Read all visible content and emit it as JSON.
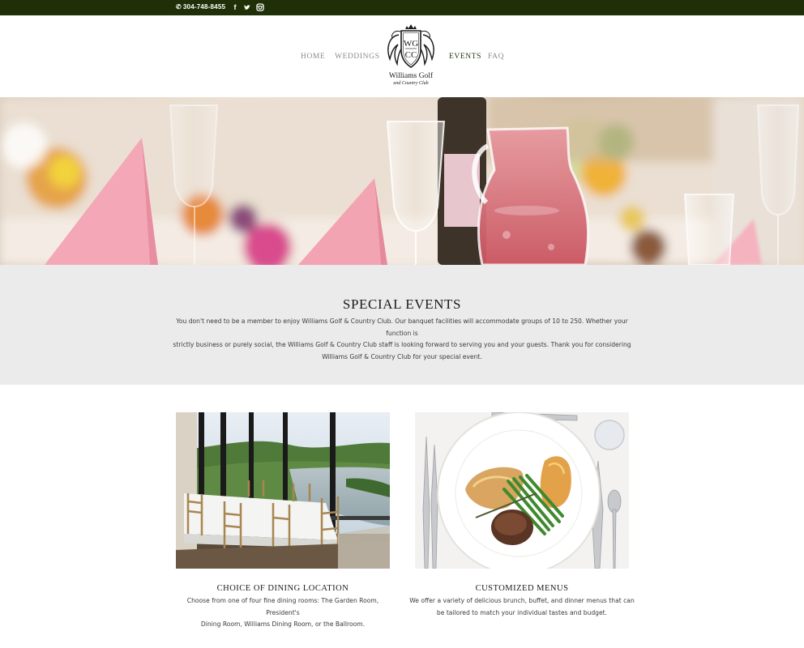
{
  "topbar": {
    "phone": "304-748-8455",
    "social": [
      "facebook-icon",
      "twitter-icon",
      "instagram-icon"
    ]
  },
  "logo": {
    "monogram_top": "WG",
    "monogram_bottom": "CC",
    "line1": "Williams Golf",
    "line2": "and Country Club"
  },
  "nav": {
    "items": [
      {
        "label": "HOME",
        "active": false
      },
      {
        "label": "WEDDINGS",
        "active": false
      },
      {
        "label": "EVENTS",
        "active": true
      },
      {
        "label": "FAQ",
        "active": false
      }
    ]
  },
  "events": {
    "title": "SPECIAL EVENTS",
    "line1": "You don't need to be a member to enjoy Williams Golf & Country Club. Our banquet facilities will accommodate groups of 10 to 250. Whether your function is",
    "line2": "strictly business or purely social, the Williams Golf & Country Club staff is looking forward to serving you and your guests.  Thank you for considering",
    "line3": "Williams Golf & Country Club for your special event."
  },
  "features": [
    {
      "title": "CHOICE OF DINING LOCATION",
      "line1": "Choose from one of four fine dining rooms: The Garden Room, President's",
      "line2": "Dining Room, Williams Dining Room, or the Ballroom."
    },
    {
      "title": "CUSTOMIZED MENUS",
      "line1": "We offer a variety of delicious brunch, buffet, and dinner menus that can",
      "line2": "be tailored to match your individual tastes and budget."
    }
  ],
  "colors": {
    "topbar": "#1f3008",
    "nav_active": "#1f3008",
    "nav_inactive": "#8a8a8a",
    "band": "#ebebeb"
  }
}
